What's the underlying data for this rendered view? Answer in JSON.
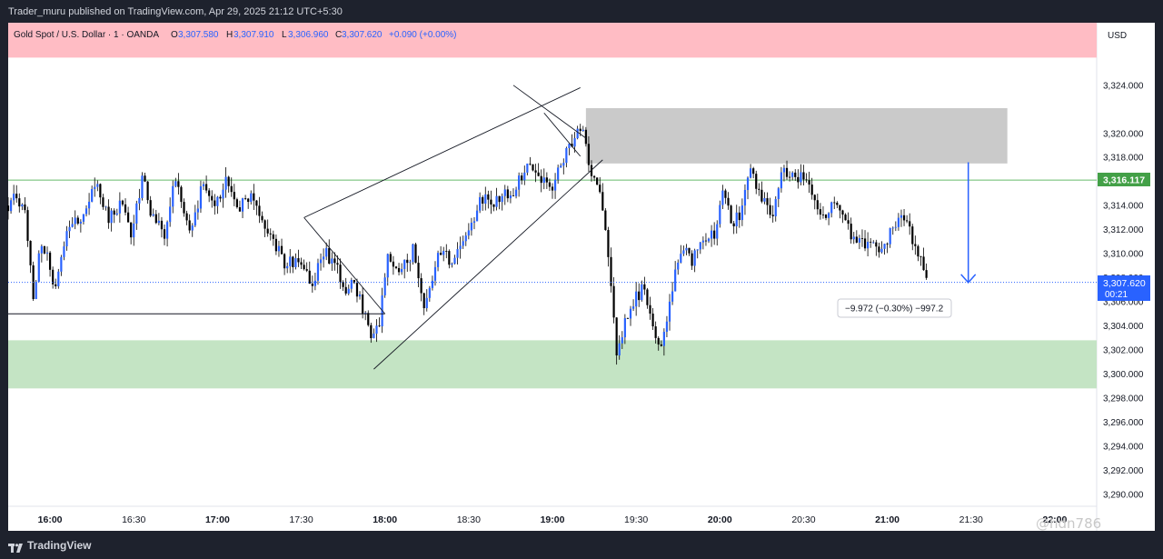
{
  "header": {
    "published_text": "Trader_muru published on TradingView.com, Apr 29, 2025 21:12 UTC+5:30"
  },
  "footer": {
    "brand": "TradingView",
    "watermark": "@hdn786"
  },
  "colors": {
    "resistance_band": "#ffbcc4",
    "support_band": "#c4e4c4",
    "supply_box": "#cacaca",
    "candle_up": "#2962ff",
    "candle_down": "#000000",
    "price_line": "#66bb6a",
    "current_price": "#2962ff",
    "measure_arrow": "#2962ff"
  },
  "chart_data": {
    "type": "candlestick",
    "title": "Gold Spot / U.S. Dollar · 1 · OANDA",
    "symbol": "Gold Spot / U.S. Dollar",
    "interval": "1",
    "exchange": "OANDA",
    "ohlc": {
      "o_label": "O",
      "o": "3,307.580",
      "h_label": "H",
      "h": "3,307.910",
      "l_label": "L",
      "l": "3,306.960",
      "c_label": "C",
      "c": "3,307.620",
      "change": "+0.090 (+0.00%)"
    },
    "currency": "USD",
    "y_ticks": [
      "3,324.000",
      "3,320.000",
      "3,318.000",
      "3,314.000",
      "3,312.000",
      "3,310.000",
      "3,308.000",
      "3,306.000",
      "3,304.000",
      "3,302.000",
      "3,300.000",
      "3,298.000",
      "3,296.000",
      "3,294.000",
      "3,292.000",
      "3,290.000"
    ],
    "y_tick_values": [
      3324,
      3320,
      3318,
      3314,
      3312,
      3310,
      3308,
      3306,
      3304,
      3302,
      3300,
      3298,
      3296,
      3294,
      3292,
      3290
    ],
    "x_ticks": [
      "16:00",
      "16:30",
      "17:00",
      "17:30",
      "18:00",
      "18:30",
      "19:00",
      "19:30",
      "20:00",
      "20:30",
      "21:00",
      "21:30",
      "22:00"
    ],
    "x_tick_minutes": [
      960,
      990,
      1020,
      1050,
      1080,
      1110,
      1140,
      1170,
      1200,
      1230,
      1260,
      1290,
      1320
    ],
    "bold_x_ticks": [
      "16:00",
      "17:00",
      "18:00",
      "19:00",
      "20:00",
      "21:00",
      "22:00"
    ],
    "time_range_minutes": [
      945,
      1335
    ],
    "price_range": [
      3289.0,
      3329.2
    ],
    "price_label": "3,316.117",
    "price_line_value": 3316.117,
    "current_price": "3,307.620",
    "current_price_value": 3307.62,
    "countdown": "00:21",
    "measure_label": "−9.972 (−0.30%) −997.2",
    "measure_from": 3317.6,
    "measure_to": 3307.6,
    "measure_time": 1289,
    "zones": [
      {
        "kind": "resistance",
        "from": 3326.3,
        "to": 3329.2
      },
      {
        "kind": "supply",
        "from": 3317.5,
        "to": 3322.1,
        "time_from": 1152,
        "time_to": 1303
      },
      {
        "kind": "support",
        "from": 3298.8,
        "to": 3302.8
      }
    ],
    "trendlines": [
      {
        "time": [
          1126,
          1152
        ],
        "price": [
          3324.0,
          3319.6
        ]
      },
      {
        "time": [
          1137,
          1150
        ],
        "price": [
          3321.7,
          3318.1
        ]
      },
      {
        "time": [
          1051,
          1150
        ],
        "price": [
          3313.0,
          3323.8
        ]
      },
      {
        "time": [
          1076,
          1158
        ],
        "price": [
          3300.4,
          3317.8
        ]
      },
      {
        "time": [
          945,
          1080
        ],
        "price": [
          3305.0,
          3305.0
        ]
      },
      {
        "time": [
          1051,
          1080
        ],
        "price": [
          3313.0,
          3305.0
        ]
      }
    ],
    "price_path": [
      [
        945,
        3314.0
      ],
      [
        947,
        3315.2
      ],
      [
        951,
        3313.6
      ],
      [
        954,
        3306.5
      ],
      [
        957,
        3311.0
      ],
      [
        962,
        3307.3
      ],
      [
        966,
        3312.1
      ],
      [
        971,
        3313.1
      ],
      [
        977,
        3315.8
      ],
      [
        981,
        3313.0
      ],
      [
        985,
        3314.1
      ],
      [
        989,
        3311.8
      ],
      [
        993,
        3316.3
      ],
      [
        997,
        3312.7
      ],
      [
        1001,
        3311.6
      ],
      [
        1005,
        3316.2
      ],
      [
        1010,
        3311.5
      ],
      [
        1015,
        3316.0
      ],
      [
        1019,
        3314.1
      ],
      [
        1023,
        3315.9
      ],
      [
        1028,
        3313.8
      ],
      [
        1032,
        3314.9
      ],
      [
        1036,
        3312.7
      ],
      [
        1040,
        3311.0
      ],
      [
        1044,
        3309.2
      ],
      [
        1049,
        3309.4
      ],
      [
        1054,
        3307.6
      ],
      [
        1058,
        3310.1
      ],
      [
        1062,
        3309.3
      ],
      [
        1065,
        3307.1
      ],
      [
        1069,
        3307.6
      ],
      [
        1072,
        3305.5
      ],
      [
        1075,
        3303.4
      ],
      [
        1078,
        3304.5
      ],
      [
        1081,
        3309.5
      ],
      [
        1086,
        3308.5
      ],
      [
        1090,
        3310.3
      ],
      [
        1094,
        3305.6
      ],
      [
        1099,
        3310.0
      ],
      [
        1104,
        3309.4
      ],
      [
        1110,
        3312.1
      ],
      [
        1115,
        3314.6
      ],
      [
        1121,
        3314.4
      ],
      [
        1126,
        3315.3
      ],
      [
        1131,
        3317.1
      ],
      [
        1136,
        3316.4
      ],
      [
        1140,
        3315.2
      ],
      [
        1144,
        3318.0
      ],
      [
        1148,
        3320.0
      ],
      [
        1151,
        3319.9
      ],
      [
        1154,
        3316.9
      ],
      [
        1158,
        3314.0
      ],
      [
        1160,
        3309.2
      ],
      [
        1163,
        3301.9
      ],
      [
        1166,
        3304.1
      ],
      [
        1169,
        3306.0
      ],
      [
        1173,
        3307.2
      ],
      [
        1176,
        3303.6
      ],
      [
        1179,
        3301.9
      ],
      [
        1182,
        3306.0
      ],
      [
        1186,
        3310.3
      ],
      [
        1190,
        3309.5
      ],
      [
        1194,
        3311.1
      ],
      [
        1198,
        3311.4
      ],
      [
        1201,
        3315.2
      ],
      [
        1204,
        3312.8
      ],
      [
        1207,
        3312.9
      ],
      [
        1211,
        3316.8
      ],
      [
        1215,
        3314.8
      ],
      [
        1219,
        3313.4
      ],
      [
        1222,
        3317.0
      ],
      [
        1227,
        3316.0
      ],
      [
        1230,
        3316.6
      ],
      [
        1234,
        3314.3
      ],
      [
        1237,
        3313.3
      ],
      [
        1241,
        3314.3
      ],
      [
        1245,
        3312.9
      ],
      [
        1249,
        3310.6
      ],
      [
        1254,
        3311.1
      ],
      [
        1258,
        3310.2
      ],
      [
        1262,
        3312.0
      ],
      [
        1266,
        3313.1
      ],
      [
        1270,
        3310.5
      ],
      [
        1273,
        3309.1
      ],
      [
        1274.5,
        3307.6
      ]
    ]
  }
}
